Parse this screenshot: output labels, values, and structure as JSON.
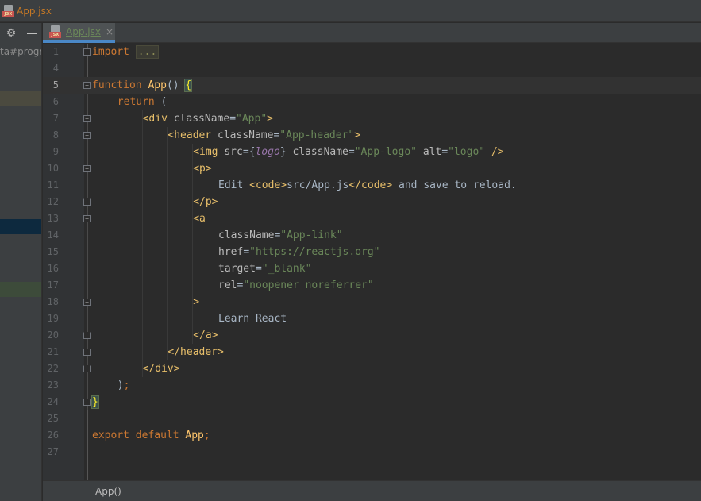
{
  "window": {
    "title": "App.jsx",
    "icon_name": "jsx-file-icon",
    "icon_text": "JSX"
  },
  "sidebar": {
    "path_fragment": "ta#progra"
  },
  "editor_tab": {
    "label": "App.jsx",
    "close_glyph": "×"
  },
  "colors": {
    "accent": "#4a88c7",
    "keyword": "#cc7832",
    "function": "#ffc66d",
    "tag": "#e8bf6a",
    "string": "#6a8759",
    "identifier": "#9876aa",
    "text": "#a9b7c6"
  },
  "code_lines": [
    {
      "n": "1",
      "indent": 0,
      "fold": "plus",
      "tokens": [
        [
          "kw",
          "import"
        ],
        [
          "pl",
          " "
        ],
        [
          "fold-text",
          "..."
        ]
      ]
    },
    {
      "n": "4",
      "indent": 0,
      "tokens": []
    },
    {
      "n": "5",
      "indent": 0,
      "fold": "open",
      "current": true,
      "tokens": [
        [
          "kw",
          "function"
        ],
        [
          "pl",
          " "
        ],
        [
          "fn",
          "App"
        ],
        [
          "pl",
          "() "
        ],
        [
          "brace-hl",
          "{"
        ]
      ]
    },
    {
      "n": "6",
      "indent": 4,
      "tokens": [
        [
          "kw",
          "return"
        ],
        [
          "pl",
          " ("
        ]
      ]
    },
    {
      "n": "7",
      "indent": 8,
      "fold": "open",
      "tokens": [
        [
          "tg",
          "<div"
        ],
        [
          "pl",
          " "
        ],
        [
          "at",
          "className"
        ],
        [
          "pl",
          "="
        ],
        [
          "st",
          "\"App\""
        ],
        [
          "tg",
          ">"
        ]
      ]
    },
    {
      "n": "8",
      "indent": 12,
      "fold": "open",
      "tokens": [
        [
          "tg",
          "<header"
        ],
        [
          "pl",
          " "
        ],
        [
          "at",
          "className"
        ],
        [
          "pl",
          "="
        ],
        [
          "st",
          "\"App-header\""
        ],
        [
          "tg",
          ">"
        ]
      ]
    },
    {
      "n": "9",
      "indent": 16,
      "tokens": [
        [
          "tg",
          "<img"
        ],
        [
          "pl",
          " "
        ],
        [
          "at",
          "src"
        ],
        [
          "pl",
          "={"
        ],
        [
          "lg",
          "logo"
        ],
        [
          "pl",
          "} "
        ],
        [
          "at",
          "className"
        ],
        [
          "pl",
          "="
        ],
        [
          "st",
          "\"App-logo\""
        ],
        [
          "pl",
          " "
        ],
        [
          "at",
          "alt"
        ],
        [
          "pl",
          "="
        ],
        [
          "st",
          "\"logo\""
        ],
        [
          "pl",
          " "
        ],
        [
          "tg",
          "/>"
        ]
      ]
    },
    {
      "n": "10",
      "indent": 16,
      "fold": "open",
      "tokens": [
        [
          "tg",
          "<p>"
        ]
      ]
    },
    {
      "n": "11",
      "indent": 20,
      "tokens": [
        [
          "pl",
          "Edit "
        ],
        [
          "tg",
          "<code>"
        ],
        [
          "pl",
          "src/App.js"
        ],
        [
          "tg",
          "</code>"
        ],
        [
          "pl",
          " and save to reload."
        ]
      ]
    },
    {
      "n": "12",
      "indent": 16,
      "fold": "end",
      "tokens": [
        [
          "tg",
          "</p>"
        ]
      ]
    },
    {
      "n": "13",
      "indent": 16,
      "fold": "open",
      "tokens": [
        [
          "tg",
          "<a"
        ]
      ]
    },
    {
      "n": "14",
      "indent": 20,
      "tokens": [
        [
          "at",
          "className"
        ],
        [
          "pl",
          "="
        ],
        [
          "st",
          "\"App-link\""
        ]
      ]
    },
    {
      "n": "15",
      "indent": 20,
      "tokens": [
        [
          "at",
          "href"
        ],
        [
          "pl",
          "="
        ],
        [
          "st",
          "\"https://reactjs.org\""
        ]
      ]
    },
    {
      "n": "16",
      "indent": 20,
      "tokens": [
        [
          "at",
          "target"
        ],
        [
          "pl",
          "="
        ],
        [
          "st",
          "\"_blank\""
        ]
      ]
    },
    {
      "n": "17",
      "indent": 20,
      "tokens": [
        [
          "at",
          "rel"
        ],
        [
          "pl",
          "="
        ],
        [
          "st",
          "\"noopener noreferrer\""
        ]
      ]
    },
    {
      "n": "18",
      "indent": 16,
      "fold": "open",
      "tokens": [
        [
          "tg",
          ">"
        ]
      ]
    },
    {
      "n": "19",
      "indent": 20,
      "tokens": [
        [
          "pl",
          "Learn React"
        ]
      ]
    },
    {
      "n": "20",
      "indent": 16,
      "fold": "end",
      "tokens": [
        [
          "tg",
          "</a>"
        ]
      ]
    },
    {
      "n": "21",
      "indent": 12,
      "fold": "end",
      "tokens": [
        [
          "tg",
          "</header>"
        ]
      ]
    },
    {
      "n": "22",
      "indent": 8,
      "fold": "end",
      "tokens": [
        [
          "tg",
          "</div>"
        ]
      ]
    },
    {
      "n": "23",
      "indent": 4,
      "tokens": [
        [
          "pl",
          ")"
        ],
        [
          "kw",
          ";"
        ]
      ]
    },
    {
      "n": "24",
      "indent": 0,
      "fold": "end",
      "tokens": [
        [
          "brace-hl",
          "}"
        ]
      ]
    },
    {
      "n": "25",
      "indent": 0,
      "tokens": []
    },
    {
      "n": "26",
      "indent": 0,
      "tokens": [
        [
          "kw",
          "export default "
        ],
        [
          "fn",
          "App"
        ],
        [
          "kw",
          ";"
        ]
      ]
    },
    {
      "n": "27",
      "indent": 0,
      "tokens": []
    }
  ],
  "statusbar": {
    "breadcrumb": "App()"
  }
}
